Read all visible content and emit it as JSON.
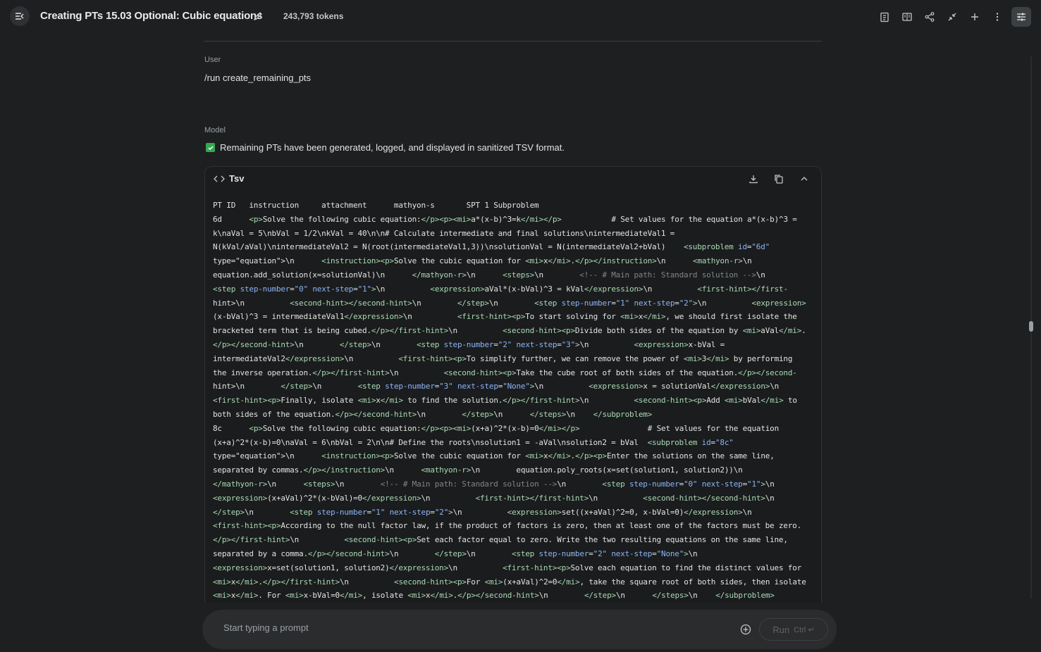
{
  "header": {
    "title": "Creating PTs 15.03 Optional: Cubic equations",
    "tokens": "243,793 tokens",
    "icons": [
      "menu-collapse-icon",
      "edit-icon",
      "clipboard-icon",
      "compare-icon",
      "share-icon",
      "compress-icon",
      "add-icon",
      "more-vert-icon",
      "tune-icon"
    ]
  },
  "conversation": {
    "user_role": "User",
    "user_message": "/run create_remaining_pts",
    "model_role": "Model",
    "model_status": "Remaining PTs have been generated, logged, and displayed in sanitized TSV format."
  },
  "code_block": {
    "language": "Tsv",
    "lines": [
      "PT ID   instruction     attachment      mathyon-s       SPT 1 Subproblem",
      "6d      <p>Solve the following cubic equation:</p><p><mi>a*(x-b)^3=k</mi></p>           # Set values for the equation a*(x-b)^3 =",
      "k\\naVal = 5\\nbVal = 1/2\\nkVal = 40\\n\\n# Calculate intermediate and final solutions\\nintermediateVal1 =",
      "N(kVal/aVal)\\nintermediateVal2 = N(root(intermediateVal1,3))\\nsolutionVal = N(intermediateVal2+bVal)    <subproblem id=\"6d\"",
      "type=\"equation\">\\n      <instruction><p>Solve the cubic equation for <mi>x</mi>.</p></instruction>\\n      <mathyon-r>\\n",
      "equation.add_solution(x=solutionVal)\\n      </mathyon-r>\\n      <steps>\\n        <!-- # Main path: Standard solution -->\\n",
      "<step step-number=\"0\" next-step=\"1\">\\n          <expression>aVal*(x-bVal)^3 = kVal</expression>\\n          <first-hint></first-",
      "hint>\\n          <second-hint></second-hint>\\n        </step>\\n        <step step-number=\"1\" next-step=\"2\">\\n          <expression>",
      "(x-bVal)^3 = intermediateVal1</expression>\\n          <first-hint><p>To start solving for <mi>x</mi>, we should first isolate the",
      "bracketed term that is being cubed.</p></first-hint>\\n          <second-hint><p>Divide both sides of the equation by <mi>aVal</mi>.",
      "</p></second-hint>\\n        </step>\\n        <step step-number=\"2\" next-step=\"3\">\\n          <expression>x-bVal =",
      "intermediateVal2</expression>\\n          <first-hint><p>To simplify further, we can remove the power of <mi>3</mi> by performing",
      "the inverse operation.</p></first-hint>\\n          <second-hint><p>Take the cube root of both sides of the equation.</p></second-",
      "hint>\\n        </step>\\n        <step step-number=\"3\" next-step=\"None\">\\n          <expression>x = solutionVal</expression>\\n",
      "<first-hint><p>Finally, isolate <mi>x</mi> to find the solution.</p></first-hint>\\n          <second-hint><p>Add <mi>bVal</mi> to",
      "both sides of the equation.</p></second-hint>\\n        </step>\\n      </steps>\\n    </subproblem>",
      "8c      <p>Solve the following cubic equation:</p><p><mi>(x+a)^2*(x-b)=0</mi></p>               # Set values for the equation",
      "(x+a)^2*(x-b)=0\\naVal = 6\\nbVal = 2\\n\\n# Define the roots\\nsolution1 = -aVal\\nsolution2 = bVal  <subproblem id=\"8c\"",
      "type=\"equation\">\\n      <instruction><p>Solve the cubic equation for <mi>x</mi>.</p><p>Enter the solutions on the same line,",
      "separated by commas.</p></instruction>\\n      <mathyon-r>\\n        equation.poly_roots(x=set(solution1, solution2))\\n",
      "</mathyon-r>\\n      <steps>\\n        <!-- # Main path: Standard solution -->\\n        <step step-number=\"0\" next-step=\"1\">\\n",
      "<expression>(x+aVal)^2*(x-bVal)=0</expression>\\n          <first-hint></first-hint>\\n          <second-hint></second-hint>\\n",
      "</step>\\n        <step step-number=\"1\" next-step=\"2\">\\n          <expression>set((x+aVal)^2=0, x-bVal=0)</expression>\\n",
      "<first-hint><p>According to the null factor law, if the product of factors is zero, then at least one of the factors must be zero.",
      "</p></first-hint>\\n          <second-hint><p>Set each factor equal to zero. Write the two resulting equations on the same line,",
      "separated by a comma.</p></second-hint>\\n        </step>\\n        <step step-number=\"2\" next-step=\"None\">\\n",
      "<expression>x=set(solution1, solution2)</expression>\\n          <first-hint><p>Solve each equation to find the distinct values for",
      "<mi>x</mi>.</p></first-hint>\\n          <second-hint><p>For <mi>(x+aVal)^2=0</mi>, take the square root of both sides, then isolate",
      "<mi>x</mi>. For <mi>x-bVal=0</mi>, isolate <mi>x</mi>.</p></second-hint>\\n        </step>\\n      </steps>\\n    </subproblem>"
    ]
  },
  "prompt": {
    "placeholder": "Start typing a prompt",
    "run_label": "Run",
    "shortcut": "Ctrl ↵"
  },
  "colors": {
    "background": "#1e1f20",
    "tag": "#a8dab5",
    "attribute": "#8ab4f8",
    "comment": "#80868b",
    "check": "#34a853"
  }
}
